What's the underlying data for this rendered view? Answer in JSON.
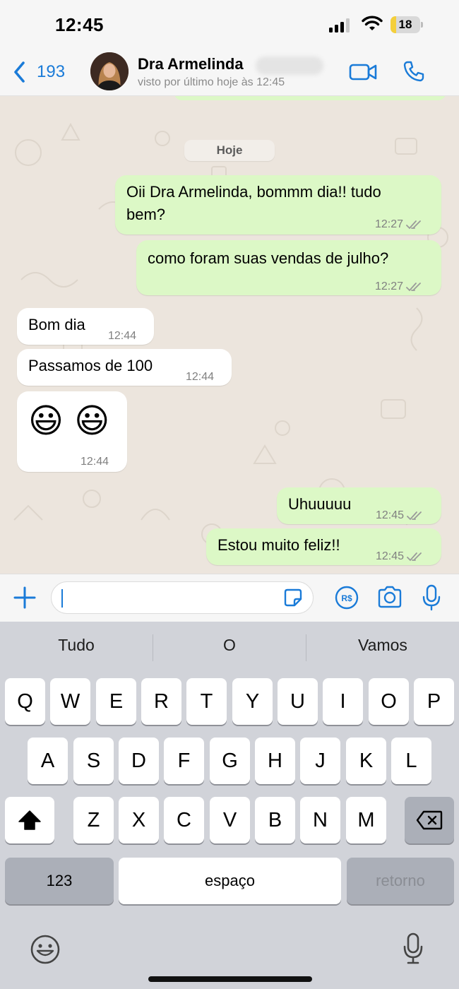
{
  "status_bar": {
    "time": "12:45",
    "battery": "18",
    "battery_level": 0.18,
    "icons": [
      "signal-icon",
      "wifi-icon",
      "battery-icon"
    ]
  },
  "header": {
    "back_count": "193",
    "contact_name": "Dra Armelinda",
    "contact_status": "visto por último hoje às 12:45",
    "icons": [
      "chevron-left-icon",
      "video-call-icon",
      "phone-icon"
    ]
  },
  "chat": {
    "date_label": "Hoje",
    "messages": [
      {
        "direction": "out",
        "text": "Oii Dra Armelinda, bommm dia!! tudo",
        "text2": "bem?",
        "time": "12:27",
        "status": "read"
      },
      {
        "direction": "out",
        "text": "como foram suas vendas de julho?",
        "time": "12:27",
        "status": "read"
      },
      {
        "direction": "in",
        "text": "Bom dia",
        "time": "12:44"
      },
      {
        "direction": "in",
        "text": "Passamos de 100",
        "time": "12:44"
      },
      {
        "direction": "in",
        "text": "😃 😃",
        "time": "12:44"
      },
      {
        "direction": "out",
        "text": "Uhuuuuu",
        "time": "12:45",
        "status": "read"
      },
      {
        "direction": "out",
        "text": "Estou muito feliz!!",
        "time": "12:45",
        "status": "read"
      }
    ]
  },
  "input_bar": {
    "value": "",
    "icons": [
      "plus-icon",
      "sticker-icon",
      "pix-payment-icon",
      "camera-icon",
      "microphone-icon"
    ]
  },
  "keyboard": {
    "suggestions": [
      "Tudo",
      "O",
      "Vamos"
    ],
    "row1": [
      "Q",
      "W",
      "E",
      "R",
      "T",
      "Y",
      "U",
      "I",
      "O",
      "P"
    ],
    "row2": [
      "A",
      "S",
      "D",
      "F",
      "G",
      "H",
      "J",
      "K",
      "L"
    ],
    "row3": [
      "Z",
      "X",
      "C",
      "V",
      "B",
      "N",
      "M"
    ],
    "numbers_key": "123",
    "space_key": "espaço",
    "return_key": "retorno",
    "icons": [
      "shift-icon",
      "backspace-icon",
      "emoji-icon",
      "dictation-icon"
    ]
  },
  "colors": {
    "accent": "#1a7bd8",
    "outgoing_bubble": "#dcf8c6",
    "incoming_bubble": "#ffffff",
    "chat_background": "#ece5dd",
    "keyboard_background": "#d1d3d9",
    "battery_fill": "#f4cf3b"
  }
}
